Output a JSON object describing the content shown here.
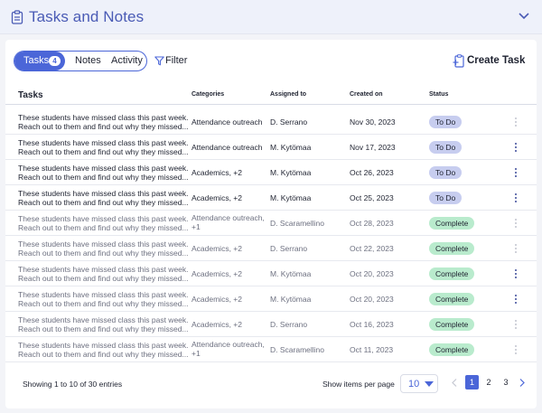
{
  "header": {
    "title": "Tasks and Notes",
    "icon": "clipboard-icon",
    "collapse_icon": "chevron-down-icon"
  },
  "tabs": {
    "tasks_label": "Tasks",
    "tasks_count": "4",
    "notes_label": "Notes",
    "activity_label": "Activity"
  },
  "toolbar": {
    "filter_label": "Filter",
    "create_label": "Create Task"
  },
  "table": {
    "headers": {
      "tasks": "Tasks",
      "categories": "Categories",
      "assigned": "Assigned to",
      "created": "Created on",
      "status": "Status"
    },
    "rows": [
      {
        "desc1": "These students have missed class this past week.",
        "desc2": "Reach out to them and find out why they missed...",
        "cat1": "Attendance outreach",
        "cat2": "",
        "assigned": "D. Serrano",
        "date": "Nov 30, 2023",
        "status": "To Do"
      },
      {
        "desc1": "These students have missed class this past week.",
        "desc2": "Reach out to them and find out why they missed...",
        "cat1": "Attendance outreach",
        "cat2": "",
        "assigned": "M. Kytömaa",
        "date": "Nov 17, 2023",
        "status": "To Do"
      },
      {
        "desc1": "These students have missed class this past week.",
        "desc2": "Reach out to them and find out why they missed...",
        "cat1": "Academics, +2",
        "cat2": "",
        "assigned": "M. Kytömaa",
        "date": "Oct 26, 2023",
        "status": "To Do"
      },
      {
        "desc1": "These students have missed class this past week.",
        "desc2": "Reach out to them and find out why they missed...",
        "cat1": "Academics, +2",
        "cat2": "",
        "assigned": "M. Kytömaa",
        "date": "Oct 25, 2023",
        "status": "To Do"
      },
      {
        "desc1": "These students have missed class this past week.",
        "desc2": "Reach out to them and find out why they missed...",
        "cat1": "Attendance outreach,",
        "cat2": "+1",
        "assigned": "D. Scaramellino",
        "date": "Oct 28, 2023",
        "status": "Complete"
      },
      {
        "desc1": "These students have missed class this past week.",
        "desc2": "Reach out to them and find out why they missed...",
        "cat1": "Academics, +2",
        "cat2": "",
        "assigned": "D. Serrano",
        "date": "Oct 22, 2023",
        "status": "Complete"
      },
      {
        "desc1": "These students have missed class this past week.",
        "desc2": "Reach out to them and find out why they missed...",
        "cat1": "Academics, +2",
        "cat2": "",
        "assigned": "M. Kytömaa",
        "date": "Oct 20, 2023",
        "status": "Complete"
      },
      {
        "desc1": "These students have missed class this past week.",
        "desc2": "Reach out to them and find out why they missed...",
        "cat1": "Academics, +2",
        "cat2": "",
        "assigned": "M. Kytömaa",
        "date": "Oct 20, 2023",
        "status": "Complete"
      },
      {
        "desc1": "These students have missed class this past week.",
        "desc2": "Reach out to them and find out why they missed...",
        "cat1": "Academics, +2",
        "cat2": "",
        "assigned": "D. Serrano",
        "date": "Oct 16, 2023",
        "status": "Complete"
      },
      {
        "desc1": "These students have missed class this past week.",
        "desc2": "Reach out to them and find out why they missed...",
        "cat1": "Attendance outreach,",
        "cat2": "+1",
        "assigned": "D. Scaramellino",
        "date": "Oct 11, 2023",
        "status": "Complete"
      }
    ]
  },
  "footer": {
    "showing": "Showing 1 to 10 of 30 entries",
    "per_page_label": "Show items per page",
    "per_page_value": "10",
    "pages": [
      "1",
      "2",
      "3"
    ],
    "current_page": "1"
  },
  "colors": {
    "accent": "#4b66d8",
    "todo_badge": "#c7cdef",
    "complete_badge": "#b9ebcd"
  }
}
